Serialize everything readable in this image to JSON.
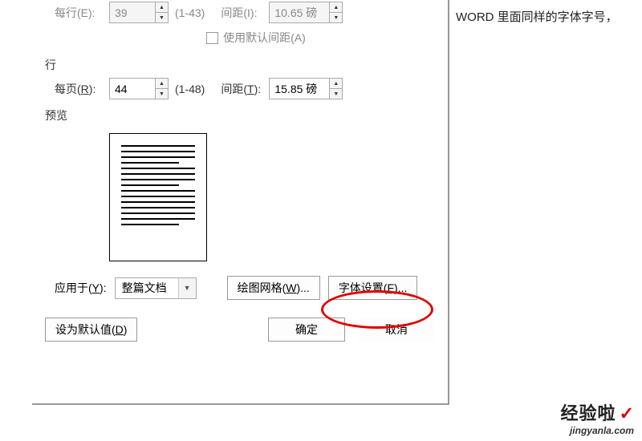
{
  "caption": "WORD 里面同样的字体字号，",
  "row1": {
    "perLineLabel": "每行(E):",
    "perLineValue": "39",
    "perLineHint": "(1-43)",
    "spacingLabel": "间距(I):",
    "spacingValue": "10.65 磅"
  },
  "checkbox": {
    "label": "使用默认间距(A)"
  },
  "sectionRow": "行",
  "row2": {
    "perPageLabel": "每页(R):",
    "perPageValue": "44",
    "perPageHint": "(1-48)",
    "spacingLabel": "间距(T):",
    "spacingValue": "15.85 磅"
  },
  "previewTitle": "预览",
  "footer": {
    "applyLabel": "应用于(Y):",
    "applyValue": "整篇文档",
    "gridBtn": "绘图网格(W)...",
    "fontBtn": "字体设置(F)..."
  },
  "bottom": {
    "defaultBtn": "设为默认值(D)",
    "okBtn": "确定",
    "cancelBtn": "取消"
  },
  "watermark": {
    "brand": "经验啦",
    "url": "jingyanla.com"
  }
}
